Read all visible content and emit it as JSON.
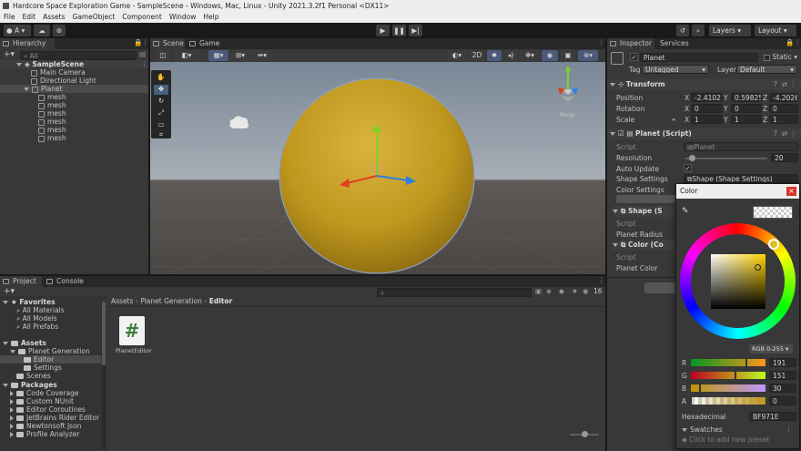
{
  "window": {
    "title": "Hardcore Space Exploration Game - SampleScene - Windows, Mac, Linux - Unity 2021.3.2f1 Personal <DX11>"
  },
  "menu": [
    "File",
    "Edit",
    "Assets",
    "GameObject",
    "Component",
    "Window",
    "Help"
  ],
  "toolbar": {
    "account": "A",
    "layers": "Layers",
    "layout": "Layout"
  },
  "hierarchy": {
    "tab": "Hierarchy",
    "search_placeholder": "All",
    "scene": "SampleScene",
    "items": [
      "Main Camera",
      "Directional Light",
      "Planet",
      "mesh",
      "mesh",
      "mesh",
      "mesh",
      "mesh",
      "mesh"
    ]
  },
  "scene_view": {
    "tabs": [
      "Scene",
      "Game"
    ],
    "mode_2d": "2D",
    "gizmo_label": "Persp",
    "sphere_color": "#BF971E"
  },
  "project": {
    "tabs": [
      "Project",
      "Console"
    ],
    "breadcrumb": [
      "Assets",
      "Planet Generation",
      "Editor"
    ],
    "count": "16",
    "favorites_label": "Favorites",
    "favorites": [
      "All Materials",
      "All Models",
      "All Prefabs"
    ],
    "assets_label": "Assets",
    "assets_tree": [
      "Planet Generation",
      "Editor",
      "Settings",
      "Scenes"
    ],
    "packages_label": "Packages",
    "packages": [
      "Code Coverage",
      "Custom NUnit",
      "Editor Coroutines",
      "JetBrains Rider Editor",
      "Newtonsoft Json",
      "Profile Analyzer"
    ],
    "file": {
      "name": "PlanetEditor",
      "glyph": "#"
    }
  },
  "inspector": {
    "tabs": [
      "Inspector",
      "Services"
    ],
    "object_name": "Planet",
    "static_label": "Static",
    "tag_label": "Tag",
    "tag_value": "Untagged",
    "layer_label": "Layer",
    "layer_value": "Default",
    "transform": {
      "title": "Transform",
      "position_label": "Position",
      "rotation_label": "Rotation",
      "scale_label": "Scale",
      "position": [
        "-2.41027",
        "0.598252",
        "-4.20267"
      ],
      "rotation": [
        "0",
        "0",
        "0"
      ],
      "scale": [
        "1",
        "1",
        "1"
      ],
      "axes": [
        "X",
        "Y",
        "Z"
      ]
    },
    "planet_script": {
      "title": "Planet (Script)",
      "script_label": "Script",
      "script_value": "Planet",
      "resolution_label": "Resolution",
      "resolution_value": "20",
      "resolution_fraction": 0.08,
      "auto_update_label": "Auto Update",
      "auto_update_mark": "✓",
      "shape_settings_label": "Shape Settings",
      "shape_settings_value": "Shape (Shape Settings)",
      "color_settings_label": "Color Settings"
    },
    "shape_section": {
      "title": "Shape (S",
      "script_label": "Script",
      "radius_label": "Planet Radius"
    },
    "color_section": {
      "title": "Color (Co",
      "script_label": "Script",
      "color_label": "Planet Color"
    }
  },
  "color_picker": {
    "title": "Color",
    "close": "×",
    "mode": "RGB 0-255",
    "channels": [
      {
        "label": "R",
        "value": "191"
      },
      {
        "label": "G",
        "value": "151"
      },
      {
        "label": "B",
        "value": "30"
      },
      {
        "label": "A",
        "value": "0"
      }
    ],
    "hex_label": "Hexadecimal",
    "hex_value": "BF971E",
    "swatches_label": "Swatches",
    "add_preset": "Click to add new preset"
  }
}
